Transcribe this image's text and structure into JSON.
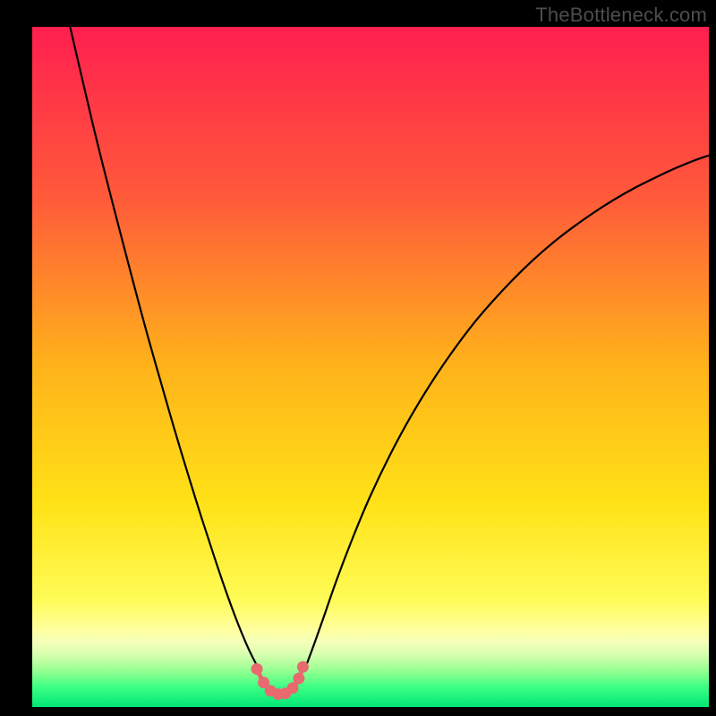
{
  "watermark": {
    "text": "TheBottleneck.com"
  },
  "chart_data": {
    "type": "line",
    "title": "",
    "xlabel": "",
    "ylabel": "",
    "xlim": [
      0,
      100
    ],
    "ylim": [
      0,
      100
    ],
    "grid": false,
    "legend": false,
    "background_gradient_stops": [
      {
        "offset": 0.0,
        "color": "#ff1f4f"
      },
      {
        "offset": 0.25,
        "color": "#ff5a3a"
      },
      {
        "offset": 0.5,
        "color": "#ffb31a"
      },
      {
        "offset": 0.7,
        "color": "#ffe217"
      },
      {
        "offset": 0.84,
        "color": "#fffb55"
      },
      {
        "offset": 0.885,
        "color": "#ffff9c"
      },
      {
        "offset": 0.905,
        "color": "#f4ffba"
      },
      {
        "offset": 0.922,
        "color": "#d8ffb0"
      },
      {
        "offset": 0.938,
        "color": "#b0ff9c"
      },
      {
        "offset": 0.954,
        "color": "#7cff8c"
      },
      {
        "offset": 0.97,
        "color": "#3dff85"
      },
      {
        "offset": 1.0,
        "color": "#00e676"
      }
    ],
    "series": [
      {
        "name": "left-curve",
        "stroke": "#000000",
        "stroke_width": 2.2,
        "fill": "none",
        "points": [
          {
            "x": 5.6,
            "y": 100.0
          },
          {
            "x": 7.0,
            "y": 94.0
          },
          {
            "x": 9.0,
            "y": 85.5
          },
          {
            "x": 11.0,
            "y": 77.5
          },
          {
            "x": 13.0,
            "y": 69.8
          },
          {
            "x": 15.0,
            "y": 62.2
          },
          {
            "x": 17.0,
            "y": 54.8
          },
          {
            "x": 19.0,
            "y": 47.8
          },
          {
            "x": 21.0,
            "y": 40.9
          },
          {
            "x": 23.0,
            "y": 34.3
          },
          {
            "x": 25.0,
            "y": 27.9
          },
          {
            "x": 27.0,
            "y": 21.8
          },
          {
            "x": 28.5,
            "y": 17.4
          },
          {
            "x": 30.0,
            "y": 13.3
          },
          {
            "x": 31.0,
            "y": 10.8
          },
          {
            "x": 32.0,
            "y": 8.5
          },
          {
            "x": 33.0,
            "y": 6.5
          },
          {
            "x": 33.7,
            "y": 5.3
          }
        ]
      },
      {
        "name": "right-curve",
        "stroke": "#000000",
        "stroke_width": 2.2,
        "fill": "none",
        "points": [
          {
            "x": 40.3,
            "y": 5.6
          },
          {
            "x": 41.5,
            "y": 8.8
          },
          {
            "x": 43.0,
            "y": 13.0
          },
          {
            "x": 45.0,
            "y": 18.7
          },
          {
            "x": 47.5,
            "y": 25.2
          },
          {
            "x": 50.0,
            "y": 31.1
          },
          {
            "x": 53.0,
            "y": 37.3
          },
          {
            "x": 56.0,
            "y": 42.8
          },
          {
            "x": 59.0,
            "y": 47.7
          },
          {
            "x": 62.0,
            "y": 52.1
          },
          {
            "x": 65.0,
            "y": 56.1
          },
          {
            "x": 68.0,
            "y": 59.6
          },
          {
            "x": 71.0,
            "y": 62.8
          },
          {
            "x": 74.0,
            "y": 65.7
          },
          {
            "x": 77.0,
            "y": 68.3
          },
          {
            "x": 80.0,
            "y": 70.6
          },
          {
            "x": 83.0,
            "y": 72.7
          },
          {
            "x": 86.0,
            "y": 74.6
          },
          {
            "x": 89.0,
            "y": 76.3
          },
          {
            "x": 92.0,
            "y": 77.8
          },
          {
            "x": 95.0,
            "y": 79.2
          },
          {
            "x": 98.0,
            "y": 80.4
          },
          {
            "x": 100.0,
            "y": 81.1
          }
        ]
      }
    ],
    "scatter": {
      "name": "trough-dots",
      "color": "#e86a6f",
      "radius": 6.5,
      "points": [
        {
          "x": 33.2,
          "y": 5.6
        },
        {
          "x": 34.2,
          "y": 3.6
        },
        {
          "x": 35.2,
          "y": 2.4
        },
        {
          "x": 36.3,
          "y": 1.9
        },
        {
          "x": 37.4,
          "y": 2.0
        },
        {
          "x": 38.5,
          "y": 2.8
        },
        {
          "x": 39.4,
          "y": 4.2
        },
        {
          "x": 40.0,
          "y": 5.9
        }
      ]
    },
    "trough_connector": {
      "stroke": "#e86a6f",
      "stroke_width": 5.0,
      "points": [
        {
          "x": 33.2,
          "y": 5.6
        },
        {
          "x": 34.2,
          "y": 3.6
        },
        {
          "x": 35.2,
          "y": 2.4
        },
        {
          "x": 36.3,
          "y": 1.9
        },
        {
          "x": 37.4,
          "y": 2.0
        },
        {
          "x": 38.5,
          "y": 2.8
        },
        {
          "x": 39.4,
          "y": 4.2
        },
        {
          "x": 40.0,
          "y": 5.9
        }
      ]
    }
  }
}
